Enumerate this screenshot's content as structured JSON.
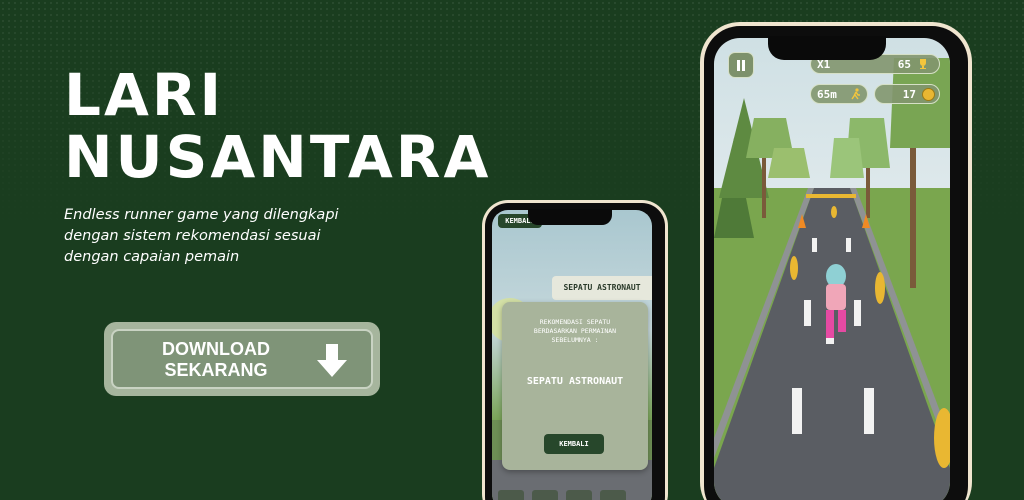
{
  "headline": {
    "line1": "LARI",
    "line2": "NUSANTARA"
  },
  "description": {
    "line1": "Endless runner game yang dilengkapi",
    "line2": "dengan sistem rekomendasi sesuai",
    "line3": "dengan capaian pemain"
  },
  "download_button": {
    "line1": "DOWNLOAD",
    "line2": "SEKARANG",
    "icon": "arrow-down-icon"
  },
  "game_hud": {
    "multiplier": "X1",
    "score": "65",
    "distance": "65m",
    "coins": "17",
    "pause_icon": "pause-icon",
    "trophy_icon": "trophy-icon",
    "runner_icon": "runner-icon",
    "coin_icon": "coin-icon"
  },
  "recommendation_screen": {
    "back_top_label": "KEMBALI",
    "tab_label": "SEPATU ASTRONAUT",
    "dialog_line1": "REKOMENDASI SEPATU",
    "dialog_line2": "BERDASARKAN PERMAINAN",
    "dialog_line3": "SEBELUMNYA :",
    "dialog_item": "SEPATU ASTRONAUT",
    "dialog_button": "KEMBALI"
  },
  "colors": {
    "background": "#1a3d1f",
    "button_outer": "#a6b59d",
    "button_inner": "#7f9478",
    "phone_frame": "#f0e5cf",
    "dark_green": "#27472b",
    "coin": "#e9b732"
  }
}
